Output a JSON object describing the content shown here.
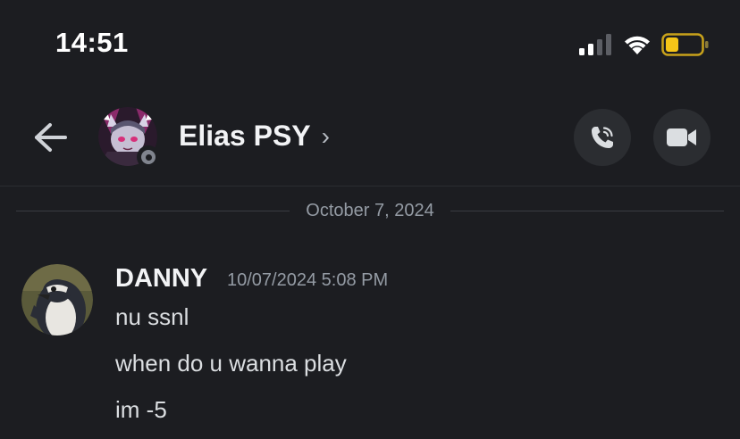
{
  "status_bar": {
    "time": "14:51",
    "icons": [
      "signal-icon",
      "wifi-icon",
      "battery-icon"
    ],
    "battery_color": "#f5c518"
  },
  "header": {
    "back_icon": "back-arrow-icon",
    "contact_name": "Elias PSY",
    "chevron": "›",
    "status": "offline",
    "call_icon": "phone-call-icon",
    "video_icon": "video-camera-icon"
  },
  "date_divider": {
    "label": "October 7, 2024"
  },
  "messages": [
    {
      "author": "DANNY",
      "timestamp": "10/07/2024 5:08 PM",
      "lines": [
        "nu ssnl",
        "when do u wanna play",
        "im -5"
      ]
    }
  ],
  "colors": {
    "background": "#1c1d21",
    "button_bg": "#2b2d31",
    "muted_text": "#949ba4",
    "primary_text": "#f2f3f5"
  }
}
